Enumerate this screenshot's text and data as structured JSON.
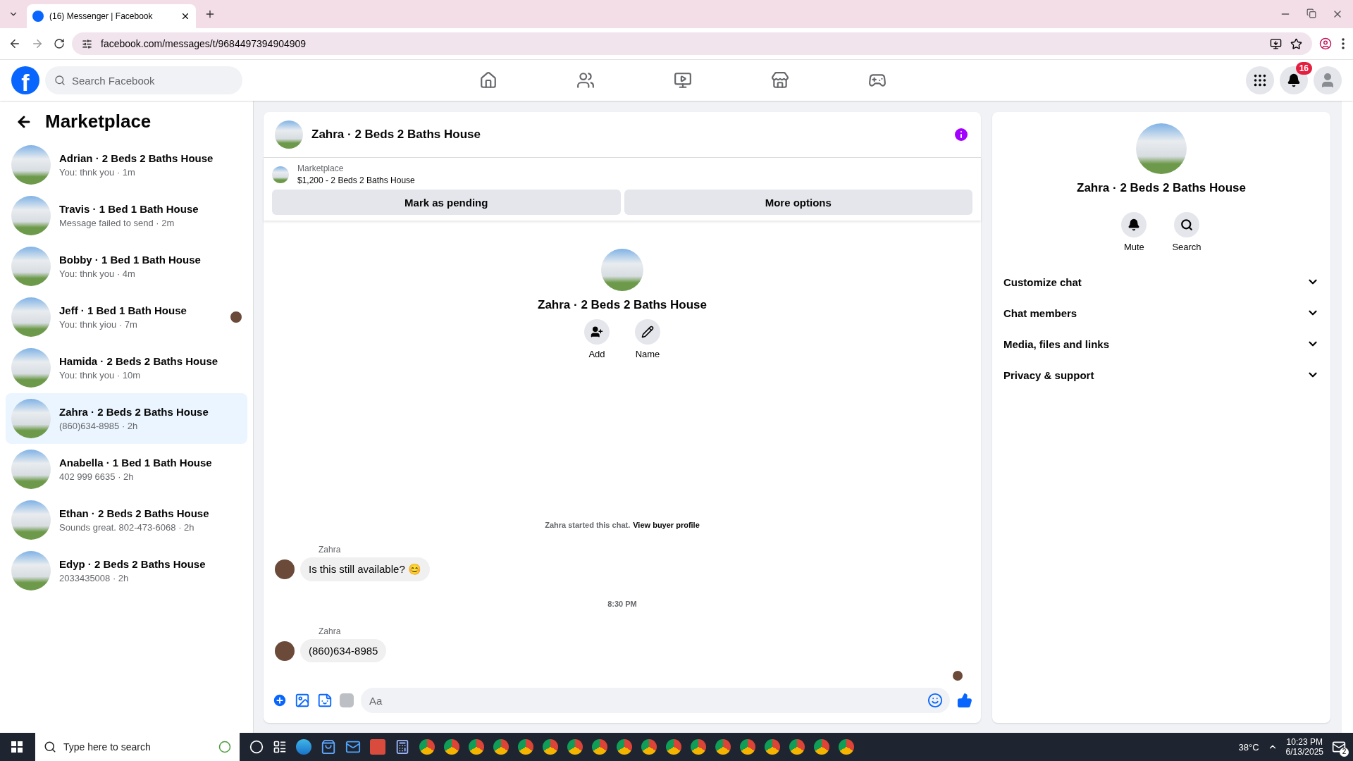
{
  "browser": {
    "tab_title": "(16) Messenger | Facebook",
    "url": "facebook.com/messages/t/9684497394904909"
  },
  "header": {
    "logo": "f",
    "search_placeholder": "Search Facebook",
    "nav": [
      {
        "kind": "home"
      },
      {
        "kind": "friends"
      },
      {
        "kind": "video"
      },
      {
        "kind": "marketplace"
      },
      {
        "kind": "gaming"
      }
    ],
    "notifications": "16"
  },
  "sidebar": {
    "title": "Marketplace",
    "chats": [
      {
        "name": "Adrian · 2 Beds 2 Baths House",
        "preview": "You: thnk you · 1m",
        "selected": false,
        "seen": false
      },
      {
        "name": "Travis · 1 Bed 1 Bath House",
        "preview": "Message failed to send · 2m",
        "selected": false,
        "seen": false
      },
      {
        "name": "Bobby · 1 Bed 1 Bath House",
        "preview": "You: thnk you · 4m",
        "selected": false,
        "seen": false
      },
      {
        "name": "Jeff · 1 Bed 1 Bath House",
        "preview": "You: thnk yiou · 7m",
        "selected": false,
        "seen": true
      },
      {
        "name": "Hamida · 2 Beds 2 Baths House",
        "preview": "You: thnk you · 10m",
        "selected": false,
        "seen": false
      },
      {
        "name": "Zahra · 2 Beds 2 Baths House",
        "preview": "(860)634-8985 · 2h",
        "selected": true,
        "seen": false
      },
      {
        "name": "Anabella · 1 Bed 1 Bath House",
        "preview": "402 999 6635 · 2h",
        "selected": false,
        "seen": false
      },
      {
        "name": "Ethan · 2 Beds 2 Baths House",
        "preview": "Sounds great. 802-473-6068 · 2h",
        "selected": false,
        "seen": false
      },
      {
        "name": "Edyp · 2 Beds 2 Baths House",
        "preview": "2033435008 · 2h",
        "selected": false,
        "seen": false
      }
    ]
  },
  "chat": {
    "title": "Zahra · 2 Beds 2 Baths House",
    "listing": {
      "label": "Marketplace",
      "title": "$1,200 - 2 Beds 2 Baths House"
    },
    "actions": [
      "Mark as pending",
      "More options"
    ],
    "intro": {
      "title": "Zahra · 2 Beds 2 Baths House",
      "actions": [
        {
          "kind": "add",
          "label": "Add"
        },
        {
          "kind": "name",
          "label": "Name"
        }
      ]
    },
    "started": {
      "text": "Zahra started this chat.",
      "link": "View buyer profile"
    },
    "messages": [
      {
        "kind": "message",
        "sender": "Zahra",
        "text": "Is this still available? 😊"
      },
      {
        "kind": "time",
        "text": "8:30 PM"
      },
      {
        "kind": "message",
        "sender": "Zahra",
        "text": "(860)634-8985"
      }
    ],
    "seen": true,
    "composer_placeholder": "Aa"
  },
  "details": {
    "title": "Zahra · 2 Beds 2 Baths House",
    "actions": [
      {
        "kind": "mute",
        "label": "Mute"
      },
      {
        "kind": "search",
        "label": "Search"
      }
    ],
    "sections": [
      {
        "label": "Customize chat",
        "expanded": false
      },
      {
        "label": "Chat members",
        "expanded": false
      },
      {
        "label": "Media, files and links",
        "expanded": false
      },
      {
        "label": "Privacy & support",
        "expanded": false
      }
    ]
  },
  "taskbar": {
    "search_placeholder": "Type here to search",
    "weather": "38°C",
    "time": "10:23 PM",
    "date": "6/13/2025",
    "notifications": "2"
  }
}
